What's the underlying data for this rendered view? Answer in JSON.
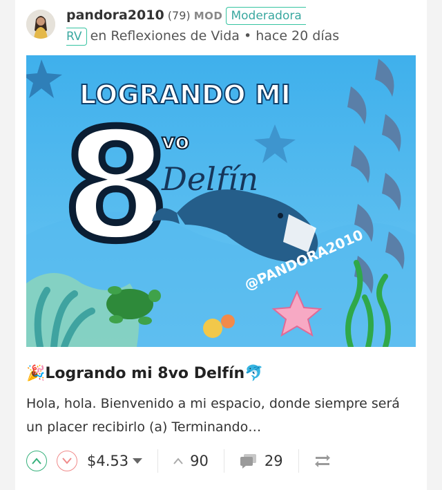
{
  "post": {
    "author": "pandora2010",
    "reputation": "(79)",
    "mod_tag": "MOD",
    "role": "Moderadora",
    "community_abbr": "RV",
    "community_line": "en Reflexiones de Vida • hace 20 días",
    "title": "🎉Logrando mi 8vo Delfín🐬",
    "excerpt": "Hola, hola. Bienvenido a mi espacio, donde siempre será un placer recibirlo (a) Terminando…"
  },
  "hero": {
    "headline": "LOGRANDO MI",
    "number": "8",
    "superscript": "vo",
    "script_word": "Delfín",
    "watermark": "@PANDORA2010"
  },
  "footer": {
    "payout": "$4.53",
    "votes": "90",
    "comments": "29"
  },
  "colors": {
    "accent": "#34c3a0",
    "upvote": "#34b07a",
    "downvote": "#f08a8a",
    "sea": "#4ab6ee"
  },
  "icons": [
    "upvote-icon",
    "downvote-icon",
    "caret-down-icon",
    "vote-count-icon",
    "comment-icon",
    "reblog-icon"
  ]
}
